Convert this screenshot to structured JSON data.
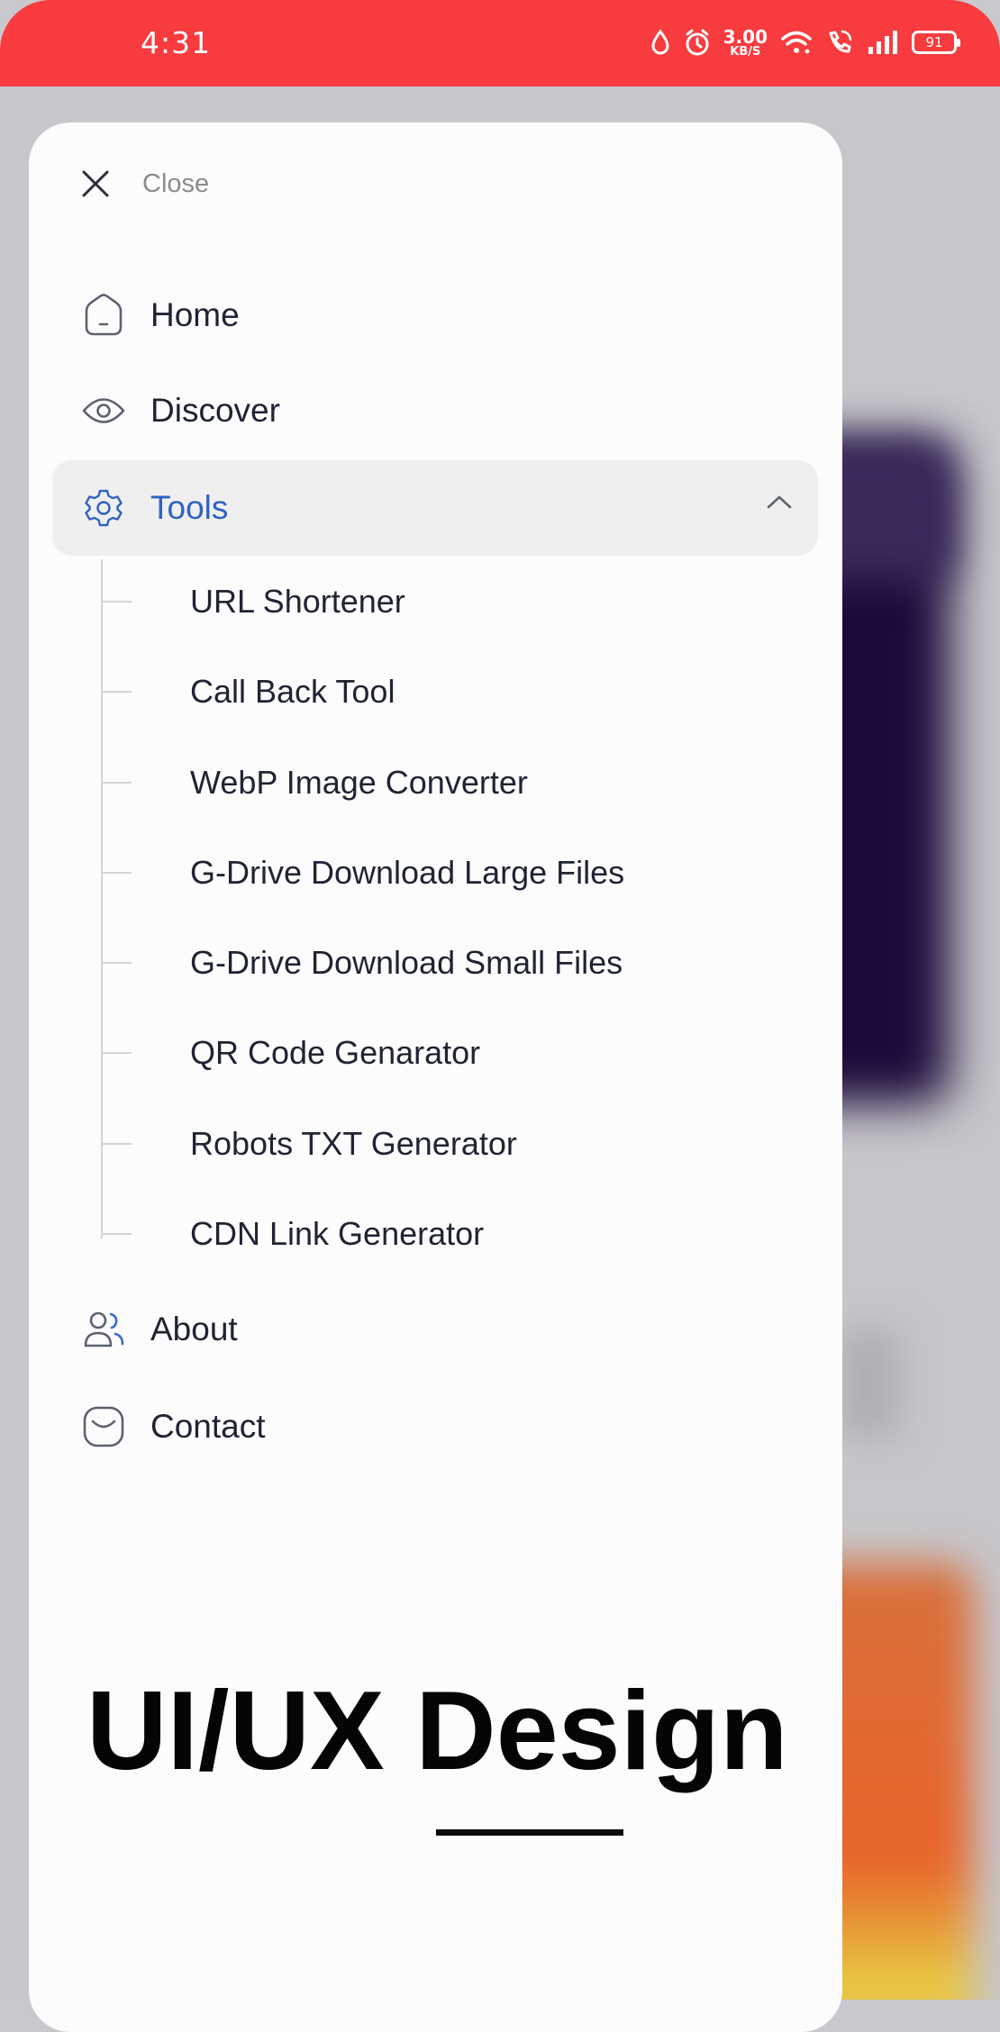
{
  "status_bar": {
    "time": "4:31",
    "net_speed_value": "3.00",
    "net_speed_unit": "KB/S",
    "battery": "91",
    "color": "#f83b3e"
  },
  "drawer": {
    "close_label": "Close",
    "items": [
      {
        "label": "Home",
        "icon": "home-icon"
      },
      {
        "label": "Discover",
        "icon": "eye-icon"
      },
      {
        "label": "Tools",
        "icon": "gear-icon",
        "expanded": true
      },
      {
        "label": "About",
        "icon": "users-icon"
      },
      {
        "label": "Contact",
        "icon": "mail-icon"
      }
    ],
    "tools_subitems": [
      "URL Shortener",
      "Call Back Tool",
      "WebP Image Converter",
      "G-Drive Download Large Files",
      "G-Drive Download Small Files",
      "QR Code Genarator",
      "Robots TXT Generator",
      "CDN Link Generator"
    ],
    "accent_color": "#2f62c3"
  },
  "overlay": {
    "title": "UI/UX Design"
  }
}
